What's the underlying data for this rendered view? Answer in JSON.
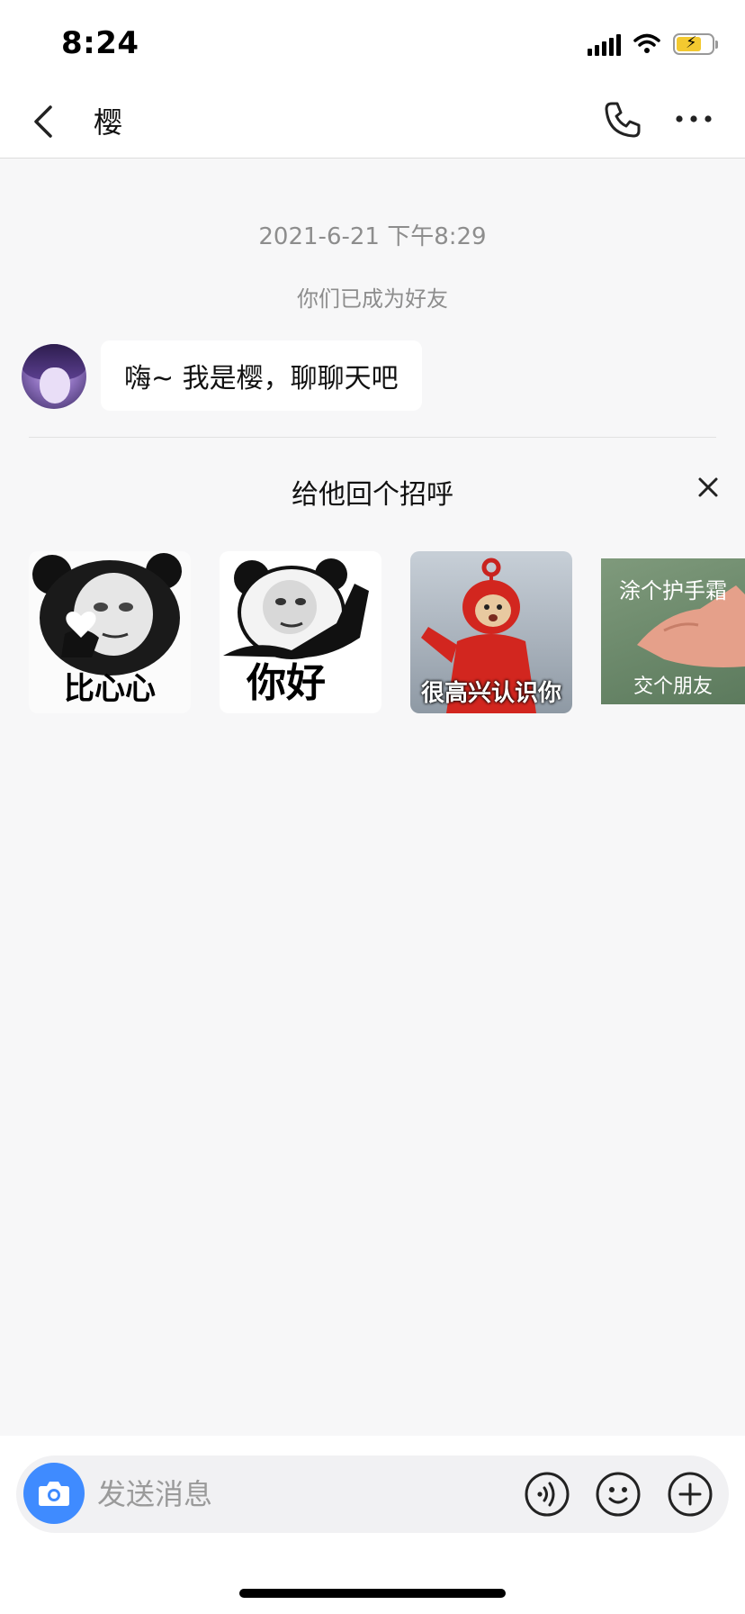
{
  "status_bar": {
    "time": "8:24"
  },
  "header": {
    "title": "樱"
  },
  "chat": {
    "timestamp": "2021-6-21 下午8:29",
    "system_message": "你们已成为好友",
    "messages": [
      {
        "text": "嗨~ 我是樱，聊聊天吧"
      }
    ]
  },
  "greeting": {
    "title": "给他回个招呼",
    "stickers": [
      {
        "caption": "比心心"
      },
      {
        "caption": "你好"
      },
      {
        "caption": "很高兴认识你"
      },
      {
        "top_text": "涂个护手霜",
        "caption": "交个朋友"
      }
    ]
  },
  "composer": {
    "placeholder": "发送消息"
  },
  "colors": {
    "accent": "#3f8bff",
    "background": "#f7f7f8",
    "secondary_text": "#8d8d8d"
  }
}
